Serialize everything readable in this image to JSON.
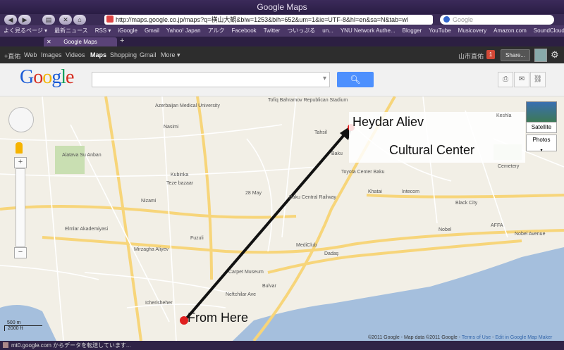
{
  "window": {
    "title": "Google Maps"
  },
  "browser": {
    "url": "http://maps.google.co.jp/maps?q=横山大観&biw=1253&bih=652&um=1&ie=UTF-8&hl=en&sa=N&tab=wl",
    "search_placeholder": "Google",
    "bookmarks": [
      "よく見るページ ▾",
      "最新ニュース",
      "RSS ▾",
      "iGoogle",
      "Gmail",
      "Yahoo! Japan",
      "アルク",
      "Facebook",
      "Twitter",
      "ついっぷる",
      "un...",
      "YNU Network Authe...",
      "Blogger",
      "YouTube",
      "Musicovery",
      "Amazon.com",
      "SoundCloud"
    ],
    "tab_label": "Google Maps",
    "status_text": "mt0.google.com からデータを転送しています..."
  },
  "gbar": {
    "links": [
      "+直佑",
      "Web",
      "Images",
      "Videos",
      "Maps",
      "Shopping",
      "Gmail",
      "More ▾"
    ],
    "user": "山市直佑",
    "notification_count": "1",
    "share_label": "Share..."
  },
  "header": {
    "logo": [
      "G",
      "o",
      "o",
      "g",
      "l",
      "e"
    ]
  },
  "map": {
    "labels": [
      "Azerbaijan Medical University",
      "Nasimi",
      "Alatava Su Anban",
      "Tofiq Bahramov Republican Stadium",
      "Baku",
      "Tahsil",
      "Toyota Center Baku",
      "Khatai",
      "Intecom",
      "Black City",
      "Keshla",
      "Kubinka",
      "Teze bazaar",
      "Nizami",
      "Elmlar Akademiyasi",
      "Fuzuli",
      "Mirzagha Aliyev",
      "Baku Central Railway",
      "Nobel",
      "AFFA",
      "MediClub",
      "Bulvar",
      "Carpet Museum",
      "Icherisheher",
      "Neftchilar Ave",
      "Nobel Avenue",
      "Cemetery",
      "28 May",
      "Dadaş"
    ],
    "annotation_destination_line1": "Heydar Aliev",
    "annotation_destination_line2": "Cultural Center",
    "annotation_origin": "From Here",
    "map_type_satellite": "Satellite",
    "map_type_photos": "Photos",
    "scale_top": "500 m",
    "scale_bottom": "2000 ft",
    "copyright": "©2011 Google - Map data ©2011 Google -",
    "terms": "Terms of Use",
    "edit_link": "Edit in Google Map Maker"
  }
}
